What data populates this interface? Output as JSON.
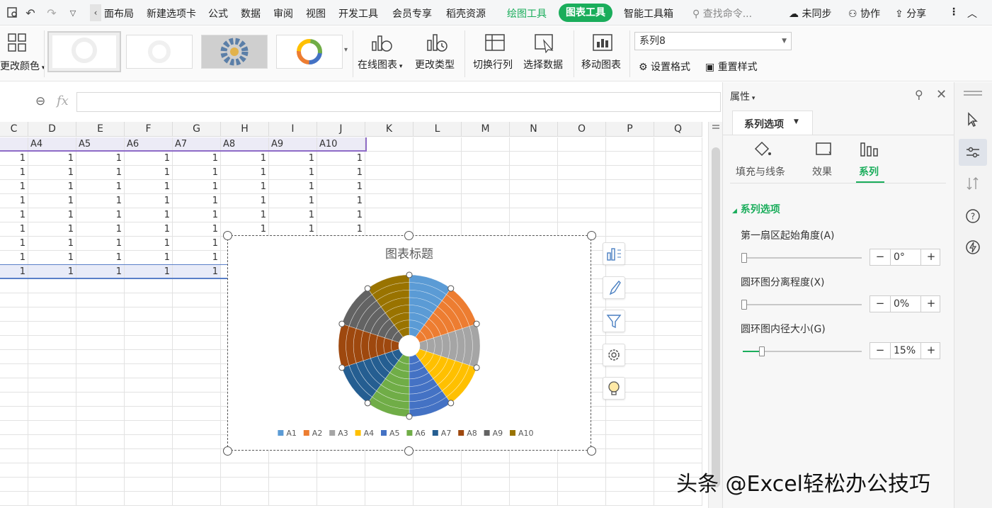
{
  "menubar": {
    "items": [
      "面布局",
      "新建选项卡",
      "公式",
      "数据",
      "审阅",
      "视图",
      "开发工具",
      "会员专享",
      "稻壳资源"
    ],
    "drawing_tools": "绘图工具",
    "chart_tools": "图表工具",
    "smart_toolbox": "智能工具箱",
    "search_placeholder": "查找命令...",
    "sync": "未同步",
    "collaborate": "协作",
    "share": "分享"
  },
  "ribbon": {
    "change_color": "更改颜色",
    "online_chart": "在线图表",
    "change_type": "更改类型",
    "switch_row_col": "切换行列",
    "select_data": "选择数据",
    "move_chart": "移动图表",
    "series_select": "系列8",
    "set_format": "设置格式",
    "reset_style": "重置样式"
  },
  "formula_bar": {
    "fx": "fx",
    "value": ""
  },
  "sheet": {
    "columns": [
      "C",
      "D",
      "E",
      "F",
      "G",
      "H",
      "I",
      "J",
      "K",
      "L",
      "M",
      "N",
      "O",
      "P",
      "Q"
    ],
    "header_row": [
      "",
      "A4",
      "A5",
      "A6",
      "A7",
      "A8",
      "A9",
      "A10"
    ],
    "cell_value": "1"
  },
  "chart_data": {
    "type": "pie",
    "title": "图表标题",
    "categories": [
      "A1",
      "A2",
      "A3",
      "A4",
      "A5",
      "A6",
      "A7",
      "A8",
      "A9",
      "A10"
    ],
    "values": [
      1,
      1,
      1,
      1,
      1,
      1,
      1,
      1,
      1,
      1
    ],
    "rings": 8,
    "hole_size_percent": 15,
    "start_angle": 0,
    "legend_position": "bottom",
    "colors": [
      "#5b9bd5",
      "#ed7d31",
      "#a5a5a5",
      "#ffc000",
      "#4472c4",
      "#70ad47",
      "#255e91",
      "#9e480e",
      "#636363",
      "#997300"
    ]
  },
  "panel": {
    "title": "属性",
    "tab": "系列选项",
    "subtabs": [
      "填充与线条",
      "效果",
      "系列"
    ],
    "section": "系列选项",
    "settings": [
      {
        "label": "第一扇区起始角度(A)",
        "value": "0°",
        "level": 0
      },
      {
        "label": "圆环图分离程度(X)",
        "value": "0%",
        "level": 0
      },
      {
        "label": "圆环图内径大小(G)",
        "value": "15%",
        "level": 0.15
      }
    ]
  },
  "watermark": "头条 @Excel轻松办公技巧"
}
